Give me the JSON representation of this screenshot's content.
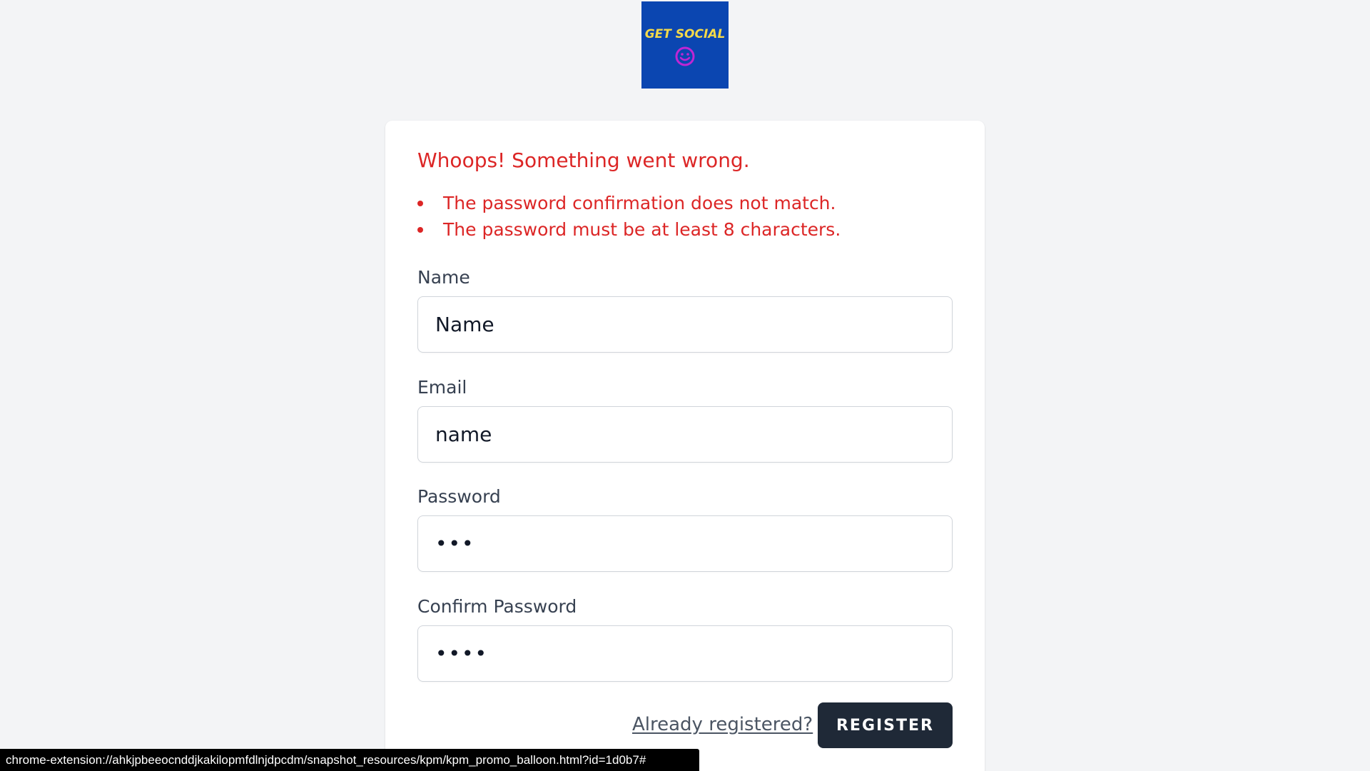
{
  "logo": {
    "text": "GET SOCIAL",
    "icon": "smiley-icon",
    "background": "#0b46b1",
    "text_color": "#f4d94a",
    "icon_color": "#c026d3"
  },
  "errors": {
    "title": "Whoops! Something went wrong.",
    "items": [
      "The password confirmation does not match.",
      "The password must be at least 8 characters."
    ],
    "color": "#dc2626"
  },
  "form": {
    "name": {
      "label": "Name",
      "value": "Name"
    },
    "email": {
      "label": "Email",
      "value": "name"
    },
    "password": {
      "label": "Password",
      "value": "•••"
    },
    "confirm_password": {
      "label": "Confirm Password",
      "value": "••••"
    },
    "already_registered_link": "Already registered?",
    "register_button": "REGISTER"
  },
  "status_bar": {
    "url": "chrome-extension://ahkjpbeeocnddjkakilopmfdlnjdpcdm/snapshot_resources/kpm/kpm_promo_balloon.html?id=1d0b7#"
  }
}
